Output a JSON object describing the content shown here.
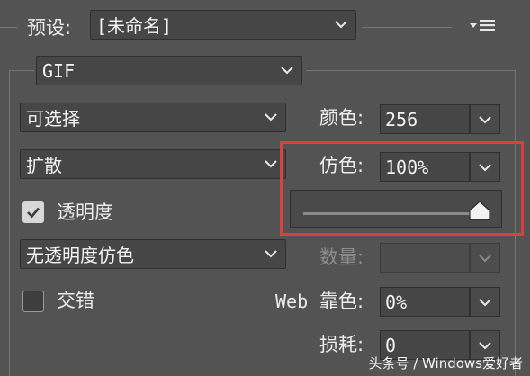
{
  "preset": {
    "label": "预设:",
    "value": "[未命名]"
  },
  "format": {
    "value": "GIF"
  },
  "reduction": {
    "value": "可选择"
  },
  "dither_algo": {
    "value": "扩散"
  },
  "transparency": {
    "label": "透明度",
    "checked": true
  },
  "matte_dither": {
    "value": "无透明度仿色"
  },
  "interlaced": {
    "label": "交错",
    "checked": false
  },
  "colors": {
    "label": "颜色:",
    "value": "256"
  },
  "dither": {
    "label": "仿色:",
    "value": "100%",
    "slider_value": 1.0
  },
  "amount": {
    "label": "数量:",
    "value": ""
  },
  "web_snap": {
    "prefix": "Web",
    "label": "靠色:",
    "value": "0%"
  },
  "lossy": {
    "label": "损耗:",
    "value": "0"
  },
  "icons": [
    "chevron-down-icon",
    "panel-menu-icon",
    "checkmark-icon",
    "slider-thumb-icon"
  ],
  "colors_palette": {
    "background": "#535353",
    "highlight": "#d94040"
  },
  "watermark": "头条号 / Windows爱好者"
}
